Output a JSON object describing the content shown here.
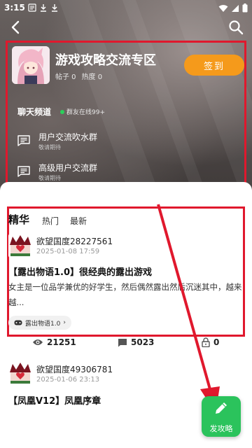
{
  "status_bar": {
    "time": "3:15"
  },
  "group": {
    "title": "游戏攻略交流专区",
    "posts_stat": "帖子 0",
    "heat_stat": "热度 0",
    "checkin_label": "签到"
  },
  "chat": {
    "title": "聊天频道",
    "online": "群友在线99+",
    "channels": [
      {
        "name": "用户交流吹水群",
        "sub": "敬请期待"
      },
      {
        "name": "高级用户交流群",
        "sub": "敬请期待"
      }
    ]
  },
  "tabs": [
    {
      "label": "精华",
      "active": true
    },
    {
      "label": "热门",
      "active": false
    },
    {
      "label": "最新",
      "active": false
    }
  ],
  "posts": [
    {
      "author": "欲望国度28227561",
      "time": "2025-01-08 17:59",
      "title": "【露出物语1.0】很经典的露出游戏",
      "excerpt": "女主是一位品学兼优的好学生，然后偶然露出然后沉迷其中，越来越...",
      "tag": "露出物语1.0",
      "views": "21251",
      "comments": "5023",
      "locks": "0"
    },
    {
      "author": "欲望国度49306781",
      "time": "2025-01-06 23:13",
      "title": "【凤凰V12】凤凰序章"
    }
  ],
  "fab": {
    "label": "发攻略"
  },
  "colors": {
    "highlight_box": "#e0182d",
    "checkin": "#f59a1b",
    "fab": "#2bc35c",
    "online_dot": "#2bcf5b"
  },
  "icons": {
    "back": "arrow-left-icon",
    "search": "search-icon",
    "channel": "chat-lines-icon",
    "views": "eye-icon",
    "comments": "comment-icon",
    "lock": "lock-icon",
    "fab": "pencil-icon",
    "tag": "gamepad-icon"
  }
}
